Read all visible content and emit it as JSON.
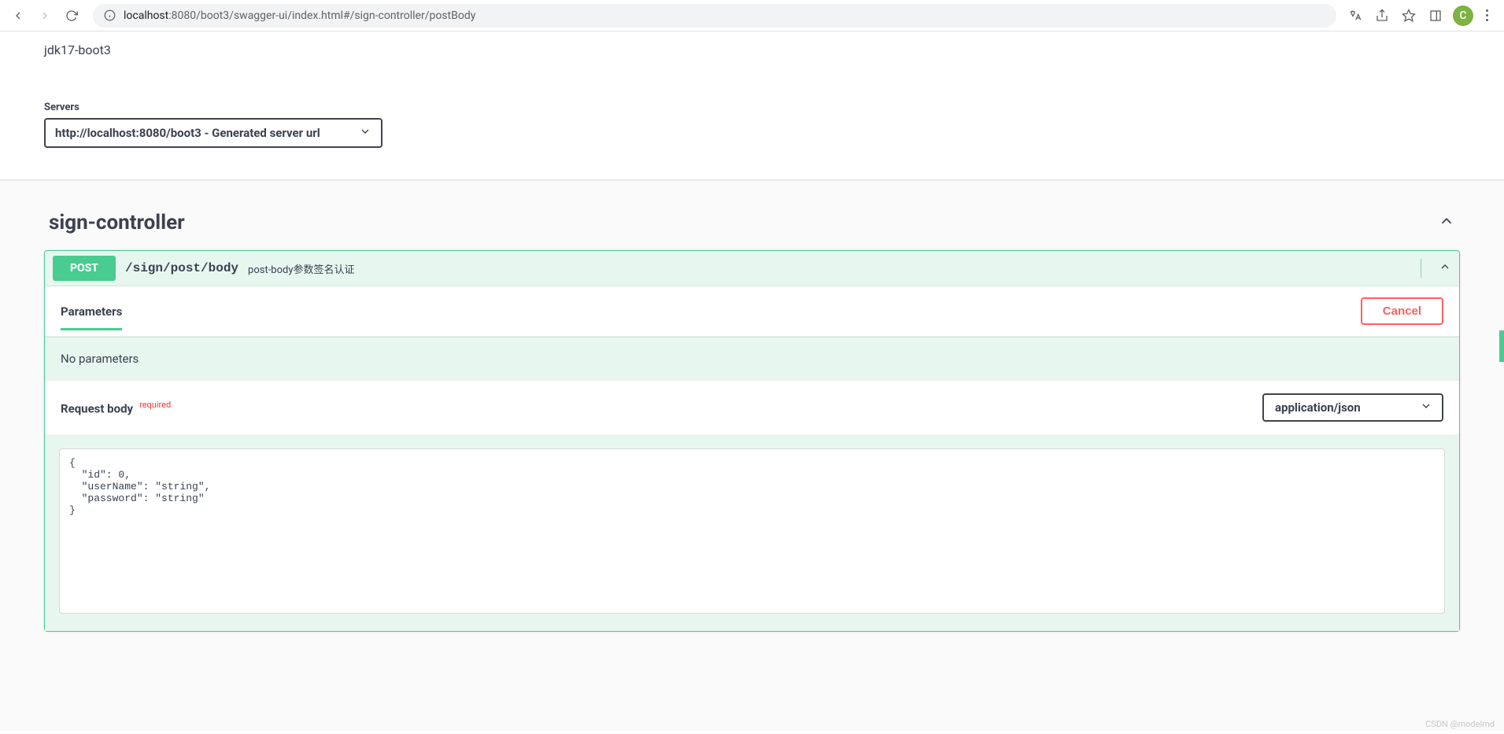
{
  "browser": {
    "url_host": "localhost",
    "url_rest": ":8080/boot3/swagger-ui/index.html#/sign-controller/postBody",
    "avatar_letter": "C"
  },
  "api": {
    "title": "jdk17-boot3",
    "servers_label": "Servers",
    "server_selected": "http://localhost:8080/boot3 - Generated server url"
  },
  "tag": {
    "name": "sign-controller"
  },
  "operation": {
    "method": "POST",
    "path": "/sign/post/body",
    "summary": "post-body参数签名认证",
    "parameters_heading": "Parameters",
    "cancel_label": "Cancel",
    "no_parameters_text": "No parameters",
    "request_body_heading": "Request body",
    "required_label": "required",
    "content_type": "application/json",
    "body_example": "{\n  \"id\": 0,\n  \"userName\": \"string\",\n  \"password\": \"string\"\n}"
  },
  "watermark": "CSDN @modelmd"
}
